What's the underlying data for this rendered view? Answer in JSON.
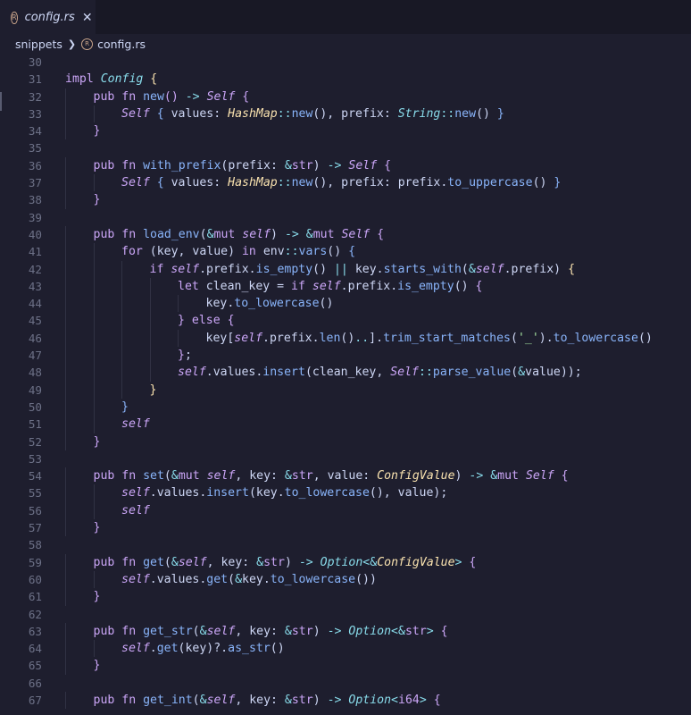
{
  "tab": {
    "title": "config.rs",
    "icon": "rust-icon",
    "close": "✕"
  },
  "breadcrumb": {
    "folder": "snippets",
    "file": "config.rs"
  },
  "editor": {
    "language": "rust",
    "lines": [
      {
        "n": "30",
        "indent": 0,
        "t": []
      },
      {
        "n": "31",
        "indent": 0,
        "t": [
          [
            "kw",
            "impl "
          ],
          [
            "ty2",
            "Config"
          ],
          [
            "br1",
            " {"
          ]
        ]
      },
      {
        "n": "32",
        "indent": 1,
        "t": [
          [
            "kw",
            "pub fn "
          ],
          [
            "fn",
            "new"
          ],
          [
            "br2",
            "()"
          ],
          [
            "op",
            " -> "
          ],
          [
            "slf",
            "Self"
          ],
          [
            "br2",
            " {"
          ]
        ]
      },
      {
        "n": "33",
        "indent": 2,
        "t": [
          [
            "slf",
            "Self"
          ],
          [
            "br3",
            " {"
          ],
          [
            "plain",
            " values: "
          ],
          [
            "ty",
            "HashMap"
          ],
          [
            "op",
            "::"
          ],
          [
            "fn",
            "new"
          ],
          [
            "plain",
            "(), prefix: "
          ],
          [
            "ty2",
            "String"
          ],
          [
            "op",
            "::"
          ],
          [
            "fn",
            "new"
          ],
          [
            "plain",
            "() "
          ],
          [
            "br3",
            "}"
          ]
        ]
      },
      {
        "n": "34",
        "indent": 1,
        "t": [
          [
            "br2",
            "}"
          ]
        ]
      },
      {
        "n": "35",
        "indent": 0,
        "t": []
      },
      {
        "n": "36",
        "indent": 1,
        "t": [
          [
            "kw",
            "pub fn "
          ],
          [
            "fn",
            "with_prefix"
          ],
          [
            "plain",
            "(prefix: "
          ],
          [
            "op",
            "&"
          ],
          [
            "kw",
            "str"
          ],
          [
            "plain",
            ") "
          ],
          [
            "op",
            "-> "
          ],
          [
            "slf",
            "Self"
          ],
          [
            "br2",
            " {"
          ]
        ]
      },
      {
        "n": "37",
        "indent": 2,
        "t": [
          [
            "slf",
            "Self"
          ],
          [
            "br3",
            " {"
          ],
          [
            "plain",
            " values: "
          ],
          [
            "ty",
            "HashMap"
          ],
          [
            "op",
            "::"
          ],
          [
            "fn",
            "new"
          ],
          [
            "plain",
            "(), prefix: prefix."
          ],
          [
            "fn",
            "to_uppercase"
          ],
          [
            "plain",
            "() "
          ],
          [
            "br3",
            "}"
          ]
        ]
      },
      {
        "n": "38",
        "indent": 1,
        "t": [
          [
            "br2",
            "}"
          ]
        ]
      },
      {
        "n": "39",
        "indent": 0,
        "t": []
      },
      {
        "n": "40",
        "indent": 1,
        "t": [
          [
            "kw",
            "pub fn "
          ],
          [
            "fn",
            "load_env"
          ],
          [
            "plain",
            "("
          ],
          [
            "op",
            "&"
          ],
          [
            "kw",
            "mut "
          ],
          [
            "slf",
            "self"
          ],
          [
            "plain",
            ") "
          ],
          [
            "op",
            "-> &"
          ],
          [
            "kw",
            "mut "
          ],
          [
            "slf",
            "Self"
          ],
          [
            "br2",
            " {"
          ]
        ]
      },
      {
        "n": "41",
        "indent": 2,
        "t": [
          [
            "kw",
            "for "
          ],
          [
            "plain",
            "(key, value) "
          ],
          [
            "kw",
            "in "
          ],
          [
            "plain",
            "env"
          ],
          [
            "op",
            "::"
          ],
          [
            "fn",
            "vars"
          ],
          [
            "plain",
            "() "
          ],
          [
            "br3",
            "{"
          ]
        ]
      },
      {
        "n": "42",
        "indent": 3,
        "t": [
          [
            "kw",
            "if "
          ],
          [
            "slf",
            "self"
          ],
          [
            "plain",
            ".prefix."
          ],
          [
            "fn",
            "is_empty"
          ],
          [
            "plain",
            "() "
          ],
          [
            "op",
            "|| "
          ],
          [
            "plain",
            "key."
          ],
          [
            "fn",
            "starts_with"
          ],
          [
            "plain",
            "("
          ],
          [
            "op",
            "&"
          ],
          [
            "slf",
            "self"
          ],
          [
            "plain",
            ".prefix) "
          ],
          [
            "br1",
            "{"
          ]
        ]
      },
      {
        "n": "43",
        "indent": 4,
        "t": [
          [
            "kw",
            "let "
          ],
          [
            "plain",
            "clean_key = "
          ],
          [
            "kw",
            "if "
          ],
          [
            "slf",
            "self"
          ],
          [
            "plain",
            ".prefix."
          ],
          [
            "fn",
            "is_empty"
          ],
          [
            "plain",
            "() "
          ],
          [
            "br2",
            "{"
          ]
        ]
      },
      {
        "n": "44",
        "indent": 5,
        "t": [
          [
            "plain",
            "key."
          ],
          [
            "fn",
            "to_lowercase"
          ],
          [
            "plain",
            "()"
          ]
        ]
      },
      {
        "n": "45",
        "indent": 4,
        "t": [
          [
            "br2",
            "}"
          ],
          [
            "kw",
            " else "
          ],
          [
            "br2",
            "{"
          ]
        ]
      },
      {
        "n": "46",
        "indent": 5,
        "t": [
          [
            "plain",
            "key["
          ],
          [
            "slf",
            "self"
          ],
          [
            "plain",
            ".prefix."
          ],
          [
            "fn",
            "len"
          ],
          [
            "plain",
            "()"
          ],
          [
            "op",
            ".."
          ],
          [
            "plain",
            "]."
          ],
          [
            "fn",
            "trim_start_matches"
          ],
          [
            "plain",
            "("
          ],
          [
            "str",
            "'_'"
          ],
          [
            "plain",
            ")."
          ],
          [
            "fn",
            "to_lowercase"
          ],
          [
            "plain",
            "()"
          ]
        ]
      },
      {
        "n": "47",
        "indent": 4,
        "t": [
          [
            "br2",
            "}"
          ],
          [
            "plain",
            ";"
          ]
        ]
      },
      {
        "n": "48",
        "indent": 4,
        "t": [
          [
            "slf",
            "self"
          ],
          [
            "plain",
            ".values."
          ],
          [
            "fn",
            "insert"
          ],
          [
            "plain",
            "(clean_key, "
          ],
          [
            "slf",
            "Self"
          ],
          [
            "op",
            "::"
          ],
          [
            "fn",
            "parse_value"
          ],
          [
            "plain",
            "("
          ],
          [
            "op",
            "&"
          ],
          [
            "plain",
            "value));"
          ]
        ]
      },
      {
        "n": "49",
        "indent": 3,
        "t": [
          [
            "br1",
            "}"
          ]
        ]
      },
      {
        "n": "50",
        "indent": 2,
        "t": [
          [
            "br3",
            "}"
          ]
        ]
      },
      {
        "n": "51",
        "indent": 2,
        "t": [
          [
            "slf",
            "self"
          ]
        ]
      },
      {
        "n": "52",
        "indent": 1,
        "t": [
          [
            "br2",
            "}"
          ]
        ]
      },
      {
        "n": "53",
        "indent": 0,
        "t": []
      },
      {
        "n": "54",
        "indent": 1,
        "t": [
          [
            "kw",
            "pub fn "
          ],
          [
            "fn",
            "set"
          ],
          [
            "plain",
            "("
          ],
          [
            "op",
            "&"
          ],
          [
            "kw",
            "mut "
          ],
          [
            "slf",
            "self"
          ],
          [
            "plain",
            ", key: "
          ],
          [
            "op",
            "&"
          ],
          [
            "kw",
            "str"
          ],
          [
            "plain",
            ", value: "
          ],
          [
            "ty",
            "ConfigValue"
          ],
          [
            "plain",
            ") "
          ],
          [
            "op",
            "-> &"
          ],
          [
            "kw",
            "mut "
          ],
          [
            "slf",
            "Self"
          ],
          [
            "br2",
            " {"
          ]
        ]
      },
      {
        "n": "55",
        "indent": 2,
        "t": [
          [
            "slf",
            "self"
          ],
          [
            "plain",
            ".values."
          ],
          [
            "fn",
            "insert"
          ],
          [
            "plain",
            "(key."
          ],
          [
            "fn",
            "to_lowercase"
          ],
          [
            "plain",
            "(), value);"
          ]
        ]
      },
      {
        "n": "56",
        "indent": 2,
        "t": [
          [
            "slf",
            "self"
          ]
        ]
      },
      {
        "n": "57",
        "indent": 1,
        "t": [
          [
            "br2",
            "}"
          ]
        ]
      },
      {
        "n": "58",
        "indent": 0,
        "t": []
      },
      {
        "n": "59",
        "indent": 1,
        "t": [
          [
            "kw",
            "pub fn "
          ],
          [
            "fn",
            "get"
          ],
          [
            "plain",
            "("
          ],
          [
            "op",
            "&"
          ],
          [
            "slf",
            "self"
          ],
          [
            "plain",
            ", key: "
          ],
          [
            "op",
            "&"
          ],
          [
            "kw",
            "str"
          ],
          [
            "plain",
            ") "
          ],
          [
            "op",
            "-> "
          ],
          [
            "ty2",
            "Option"
          ],
          [
            "op",
            "<&"
          ],
          [
            "ty",
            "ConfigValue"
          ],
          [
            "op",
            "> "
          ],
          [
            "br2",
            "{"
          ]
        ]
      },
      {
        "n": "60",
        "indent": 2,
        "t": [
          [
            "slf",
            "self"
          ],
          [
            "plain",
            ".values."
          ],
          [
            "fn",
            "get"
          ],
          [
            "plain",
            "("
          ],
          [
            "op",
            "&"
          ],
          [
            "plain",
            "key."
          ],
          [
            "fn",
            "to_lowercase"
          ],
          [
            "plain",
            "())"
          ]
        ]
      },
      {
        "n": "61",
        "indent": 1,
        "t": [
          [
            "br2",
            "}"
          ]
        ]
      },
      {
        "n": "62",
        "indent": 0,
        "t": []
      },
      {
        "n": "63",
        "indent": 1,
        "t": [
          [
            "kw",
            "pub fn "
          ],
          [
            "fn",
            "get_str"
          ],
          [
            "plain",
            "("
          ],
          [
            "op",
            "&"
          ],
          [
            "slf",
            "self"
          ],
          [
            "plain",
            ", key: "
          ],
          [
            "op",
            "&"
          ],
          [
            "kw",
            "str"
          ],
          [
            "plain",
            ") "
          ],
          [
            "op",
            "-> "
          ],
          [
            "ty2",
            "Option"
          ],
          [
            "op",
            "<&"
          ],
          [
            "kw",
            "str"
          ],
          [
            "op",
            "> "
          ],
          [
            "br2",
            "{"
          ]
        ]
      },
      {
        "n": "64",
        "indent": 2,
        "t": [
          [
            "slf",
            "self"
          ],
          [
            "plain",
            "."
          ],
          [
            "fn",
            "get"
          ],
          [
            "plain",
            "(key)?."
          ],
          [
            "fn",
            "as_str"
          ],
          [
            "plain",
            "()"
          ]
        ]
      },
      {
        "n": "65",
        "indent": 1,
        "t": [
          [
            "br2",
            "}"
          ]
        ]
      },
      {
        "n": "66",
        "indent": 0,
        "t": []
      },
      {
        "n": "67",
        "indent": 1,
        "t": [
          [
            "kw",
            "pub fn "
          ],
          [
            "fn",
            "get_int"
          ],
          [
            "plain",
            "("
          ],
          [
            "op",
            "&"
          ],
          [
            "slf",
            "self"
          ],
          [
            "plain",
            ", key: "
          ],
          [
            "op",
            "&"
          ],
          [
            "kw",
            "str"
          ],
          [
            "plain",
            ") "
          ],
          [
            "op",
            "-> "
          ],
          [
            "ty2",
            "Option"
          ],
          [
            "op",
            "<"
          ],
          [
            "kw",
            "i64"
          ],
          [
            "op",
            "> "
          ],
          [
            "br2",
            "{"
          ]
        ]
      }
    ]
  }
}
